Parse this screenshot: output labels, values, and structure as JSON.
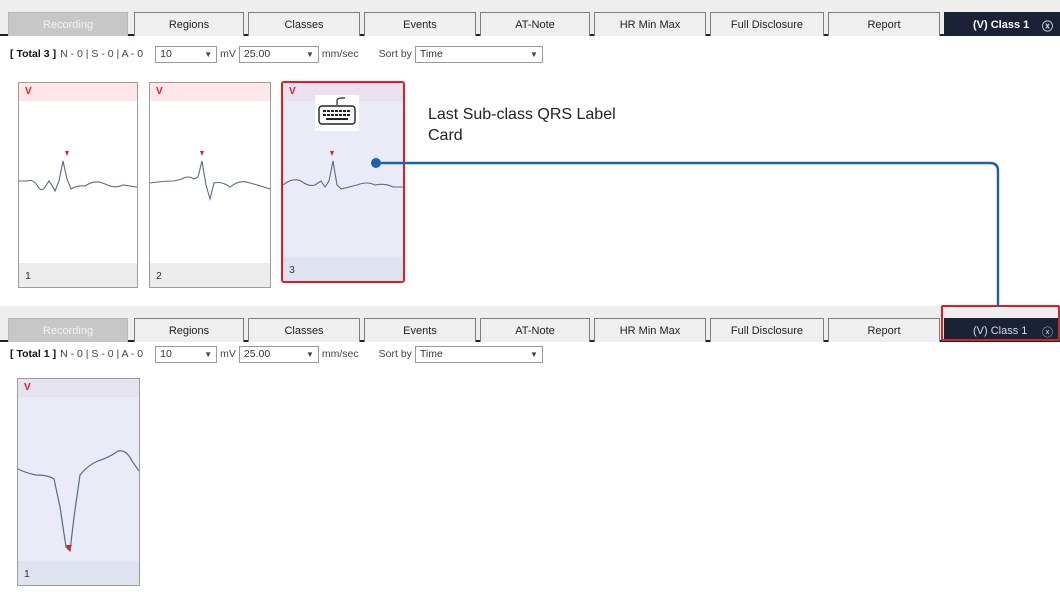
{
  "tabs": [
    {
      "label": "Recording",
      "state": "disabled"
    },
    {
      "label": "Regions",
      "state": "normal"
    },
    {
      "label": "Classes",
      "state": "normal"
    },
    {
      "label": "Events",
      "state": "normal"
    },
    {
      "label": "AT-Note",
      "state": "normal"
    },
    {
      "label": "HR Min Max",
      "state": "normal"
    },
    {
      "label": "Full Disclosure",
      "state": "normal"
    },
    {
      "label": "Report",
      "state": "normal"
    },
    {
      "label": "(V) Class 1",
      "state": "active",
      "close_glyph": "ⓧ"
    }
  ],
  "panel1": {
    "toolbar": {
      "total_bracket_open": "[",
      "total_label": "Total 3",
      "total_bracket_close": "]",
      "counts": "N - 0 | S - 0 | A - 0",
      "gain_value": "10",
      "gain_unit": "mV",
      "speed_value": "25.00",
      "speed_unit": "mm/sec",
      "sort_label": "Sort by",
      "sort_value": "Time"
    },
    "cards": [
      {
        "label": "V",
        "number": "1"
      },
      {
        "label": "V",
        "number": "2"
      },
      {
        "label": "V",
        "number": "3",
        "icon": "keyboard-icon"
      }
    ],
    "annotation": {
      "line1": "Last Sub-class QRS Label",
      "line2": "Card"
    }
  },
  "panel2": {
    "toolbar": {
      "total_bracket_open": "[",
      "total_label": "Total 1",
      "total_bracket_close": "]",
      "counts": "N - 0 | S - 0 | A - 0",
      "gain_value": "10",
      "gain_unit": "mV",
      "speed_value": "25.00",
      "speed_unit": "mm/sec",
      "sort_label": "Sort by",
      "sort_value": "Time"
    },
    "cards": [
      {
        "label": "V",
        "number": "1"
      }
    ]
  },
  "colors": {
    "active_tab": "#1b2236",
    "highlight": "#e11b22",
    "connector": "#1f5fa8",
    "ecg_trace": "#5a6a86",
    "beat_marker": "#e11b22"
  }
}
